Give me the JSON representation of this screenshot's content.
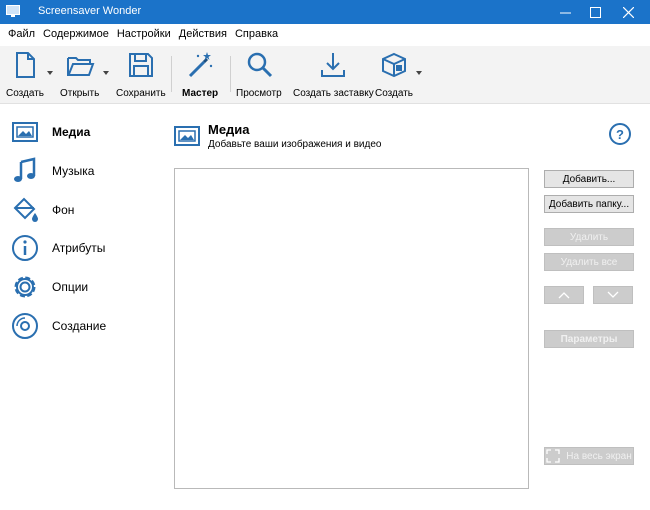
{
  "window": {
    "title": "Screensaver Wonder",
    "controls": [
      "minimize-icon",
      "maximize-icon",
      "close-icon"
    ]
  },
  "menu": [
    "Файл",
    "Содержимое",
    "Настройки",
    "Действия",
    "Справка"
  ],
  "toolbar": {
    "new_label": "Создать",
    "open_label": "Открыть",
    "save_label": "Сохранить",
    "wizard_label": "Мастер",
    "preview_label": "Просмотр",
    "create_screensaver_label": "Создать заставку",
    "build_label": "Создать"
  },
  "sidebar": {
    "items": [
      {
        "label": "Медиа",
        "icon": "image-icon",
        "active": true
      },
      {
        "label": "Музыка",
        "icon": "music-note-icon",
        "active": false
      },
      {
        "label": "Фон",
        "icon": "paint-bucket-icon",
        "active": false
      },
      {
        "label": "Атрибуты",
        "icon": "info-icon",
        "active": false
      },
      {
        "label": "Опции",
        "icon": "gear-icon",
        "active": false
      },
      {
        "label": "Создание",
        "icon": "disc-icon",
        "active": false
      }
    ]
  },
  "content": {
    "title": "Медиа",
    "subtitle": "Добавьте ваши изображения и видео",
    "help": "?"
  },
  "buttons": {
    "add": "Добавить...",
    "add_folder": "Добавить папку...",
    "remove": "Удалить",
    "remove_all": "Удалить все",
    "parameters": "Параметры",
    "fullscreen": "На весь экран"
  },
  "colors": {
    "titlebar": "#1b73c9",
    "icon_blue": "#2a6fb0",
    "toolbar_bg": "#f3f3f3",
    "disabled_button": "#cccccc"
  }
}
